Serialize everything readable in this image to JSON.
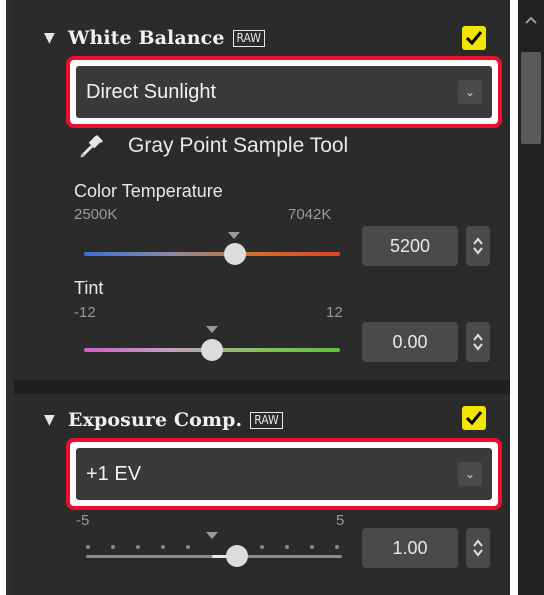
{
  "white_balance": {
    "title": "White Balance",
    "raw_badge": "RAW",
    "enabled": true,
    "preset": "Direct Sunlight",
    "gray_point_tool": "Gray Point Sample Tool",
    "color_temperature": {
      "label": "Color Temperature",
      "min_label": "2500K",
      "max_label": "7042K",
      "value": "5200"
    },
    "tint": {
      "label": "Tint",
      "min_label": "-12",
      "max_label": "12",
      "value": "0.00"
    }
  },
  "exposure_comp": {
    "title": "Exposure Comp.",
    "raw_badge": "RAW",
    "enabled": true,
    "preset": "+1 EV",
    "slider": {
      "min_label": "-5",
      "max_label": "5",
      "value": "1.00"
    }
  },
  "colors": {
    "highlight": "#e8102a",
    "checkbox": "#f2e600",
    "panel": "#2e2e2e"
  },
  "icons": [
    "triangle-down-icon",
    "raw-badge",
    "checkmark-icon",
    "chevron-down-icon",
    "eyedropper-icon",
    "spinner-arrows-icon",
    "scroll-up-icon"
  ]
}
